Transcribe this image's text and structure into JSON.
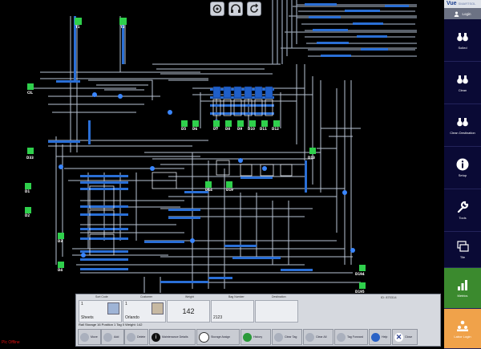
{
  "tags": [
    "T1",
    "T2",
    "CIL",
    "D33",
    "D1",
    "D2",
    "D3",
    "D4",
    "D5",
    "D6",
    "D7",
    "D8",
    "D9",
    "D10",
    "D11",
    "D12",
    "D13",
    "D14",
    "D19",
    "D194",
    "D195"
  ],
  "toolbar": {
    "icons": [
      "settings-icon",
      "headset-icon",
      "refresh-icon"
    ]
  },
  "sidebar": {
    "brand": "Vue",
    "brand_suffix": "SMARTSOL",
    "login_label": "Login",
    "items": [
      {
        "label": "Soiled"
      },
      {
        "label": "Clean"
      },
      {
        "label": "Clean Destination"
      },
      {
        "label": "Setup"
      },
      {
        "label": "Tools"
      },
      {
        "label": "Tile"
      },
      {
        "label": "Metrics"
      },
      {
        "label": "Labor Login"
      }
    ]
  },
  "panel": {
    "id_text": "ID: 870314",
    "fields": {
      "sort_code_label": "Sort Code",
      "sort_code_value": "1",
      "sort_code_name": "Sheets",
      "customer_label": "Customer",
      "customer_value": "1",
      "customer_name": "Orlando",
      "weight_label": "Weight",
      "weight_value": "142",
      "bag_number_label": "Bag Number",
      "bag_number_value": "2123",
      "destination_label": "Destination"
    },
    "status_line": "Rail Storage 16 Position 1 Tag 0 Weight: 142",
    "buttons": [
      {
        "label": "Move"
      },
      {
        "label": "Add"
      },
      {
        "label": "Delete"
      },
      {
        "label": "Maintenance Details"
      },
      {
        "label": "Storage Assign"
      },
      {
        "label": "History"
      },
      {
        "label": "Clear Tag"
      },
      {
        "label": "Clear All"
      },
      {
        "label": "Tag Forward"
      },
      {
        "label": "Help"
      },
      {
        "label": "Close"
      }
    ]
  },
  "status": {
    "plc": "Plc Offline"
  }
}
